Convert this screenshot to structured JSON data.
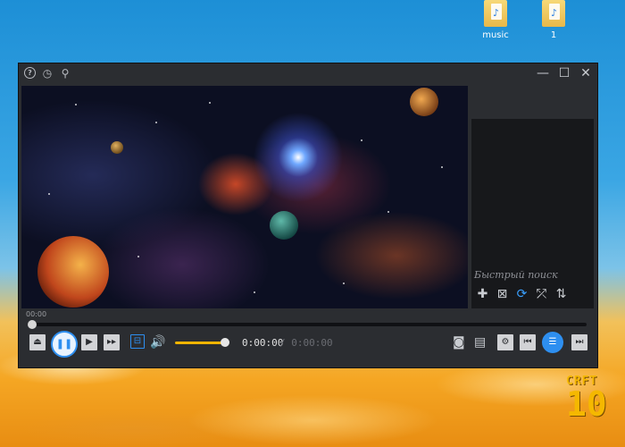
{
  "desktop": {
    "icons": [
      {
        "label": "music",
        "icon": "music-folder-icon"
      },
      {
        "label": "1",
        "icon": "music-folder-icon"
      }
    ]
  },
  "player": {
    "titlebar": {
      "help_icon": "?",
      "minimize": "—",
      "maximize": "☐",
      "close": "✕"
    },
    "playlist": {
      "search_placeholder": "Быстрый поиск"
    },
    "timeline": {
      "start_label": "00:00"
    },
    "time": {
      "current": "0:00:00",
      "total": "/ 0:00:00"
    },
    "volume_level": 0.85,
    "accent_color": "#2e8ff0",
    "volume_color": "#f0b400"
  },
  "watermark": {
    "line1": "CRFT",
    "line2": "10"
  }
}
